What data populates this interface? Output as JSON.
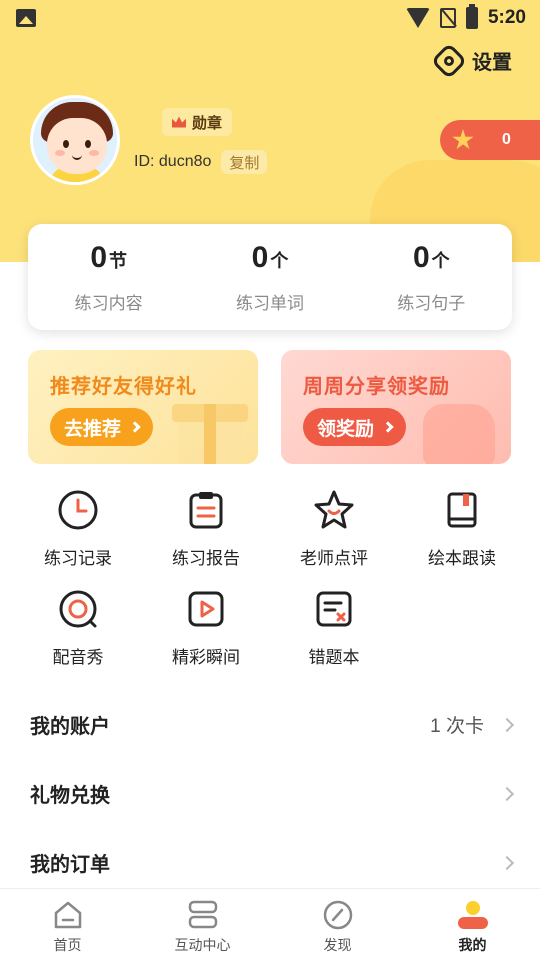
{
  "status_bar": {
    "time": "5:20",
    "icons": [
      "gallery-icon",
      "wifi-icon",
      "no-sim-icon",
      "battery-charging-icon"
    ]
  },
  "header": {
    "settings_label": "设置",
    "settings_icon": "gear-icon"
  },
  "profile": {
    "medal_label": "勋章",
    "id_text": "ID: ducn8o",
    "copy_label": "复制",
    "stars_count": "0"
  },
  "stats": [
    {
      "value": "0",
      "unit": "节",
      "label": "练习内容"
    },
    {
      "value": "0",
      "unit": "个",
      "label": "练习单词"
    },
    {
      "value": "0",
      "unit": "个",
      "label": "练习句子"
    }
  ],
  "promos": {
    "left": {
      "title": "推荐好友得好礼",
      "button": "去推荐"
    },
    "right": {
      "title": "周周分享领奖励",
      "button": "领奖励"
    }
  },
  "features": [
    {
      "label": "练习记录",
      "icon": "clock-icon"
    },
    {
      "label": "练习报告",
      "icon": "clipboard-icon"
    },
    {
      "label": "老师点评",
      "icon": "star-face-icon"
    },
    {
      "label": "绘本跟读",
      "icon": "book-icon"
    },
    {
      "label": "配音秀",
      "icon": "record-icon"
    },
    {
      "label": "精彩瞬间",
      "icon": "play-icon"
    },
    {
      "label": "错题本",
      "icon": "wrong-note-icon"
    }
  ],
  "menu": [
    {
      "label": "我的账户",
      "value": "1 次卡"
    },
    {
      "label": "礼物兑换",
      "value": ""
    },
    {
      "label": "我的订单",
      "value": ""
    }
  ],
  "tabbar": [
    {
      "label": "首页",
      "icon": "home-icon"
    },
    {
      "label": "互动中心",
      "icon": "stack-icon"
    },
    {
      "label": "发现",
      "icon": "compass-icon"
    },
    {
      "label": "我的",
      "icon": "profile-icon",
      "active": true
    }
  ],
  "colors": {
    "header_bg": "#fde27a",
    "accent_red": "#f06248",
    "accent_orange": "#f8a11c"
  }
}
